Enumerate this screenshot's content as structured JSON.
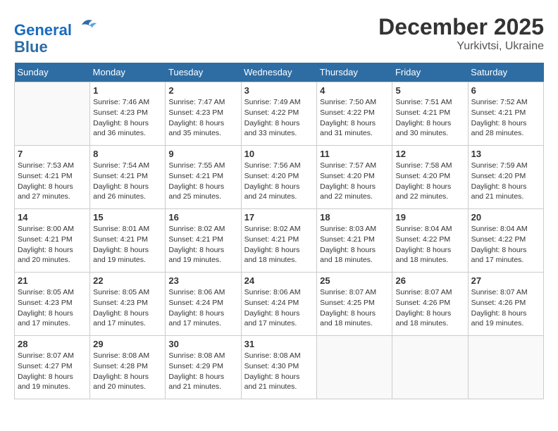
{
  "header": {
    "logo_line1": "General",
    "logo_line2": "Blue",
    "month": "December 2025",
    "location": "Yurkivtsi, Ukraine"
  },
  "weekdays": [
    "Sunday",
    "Monday",
    "Tuesday",
    "Wednesday",
    "Thursday",
    "Friday",
    "Saturday"
  ],
  "weeks": [
    [
      {
        "day": "",
        "text": ""
      },
      {
        "day": "1",
        "text": "Sunrise: 7:46 AM\nSunset: 4:23 PM\nDaylight: 8 hours\nand 36 minutes."
      },
      {
        "day": "2",
        "text": "Sunrise: 7:47 AM\nSunset: 4:23 PM\nDaylight: 8 hours\nand 35 minutes."
      },
      {
        "day": "3",
        "text": "Sunrise: 7:49 AM\nSunset: 4:22 PM\nDaylight: 8 hours\nand 33 minutes."
      },
      {
        "day": "4",
        "text": "Sunrise: 7:50 AM\nSunset: 4:22 PM\nDaylight: 8 hours\nand 31 minutes."
      },
      {
        "day": "5",
        "text": "Sunrise: 7:51 AM\nSunset: 4:21 PM\nDaylight: 8 hours\nand 30 minutes."
      },
      {
        "day": "6",
        "text": "Sunrise: 7:52 AM\nSunset: 4:21 PM\nDaylight: 8 hours\nand 28 minutes."
      }
    ],
    [
      {
        "day": "7",
        "text": "Sunrise: 7:53 AM\nSunset: 4:21 PM\nDaylight: 8 hours\nand 27 minutes."
      },
      {
        "day": "8",
        "text": "Sunrise: 7:54 AM\nSunset: 4:21 PM\nDaylight: 8 hours\nand 26 minutes."
      },
      {
        "day": "9",
        "text": "Sunrise: 7:55 AM\nSunset: 4:21 PM\nDaylight: 8 hours\nand 25 minutes."
      },
      {
        "day": "10",
        "text": "Sunrise: 7:56 AM\nSunset: 4:20 PM\nDaylight: 8 hours\nand 24 minutes."
      },
      {
        "day": "11",
        "text": "Sunrise: 7:57 AM\nSunset: 4:20 PM\nDaylight: 8 hours\nand 22 minutes."
      },
      {
        "day": "12",
        "text": "Sunrise: 7:58 AM\nSunset: 4:20 PM\nDaylight: 8 hours\nand 22 minutes."
      },
      {
        "day": "13",
        "text": "Sunrise: 7:59 AM\nSunset: 4:20 PM\nDaylight: 8 hours\nand 21 minutes."
      }
    ],
    [
      {
        "day": "14",
        "text": "Sunrise: 8:00 AM\nSunset: 4:21 PM\nDaylight: 8 hours\nand 20 minutes."
      },
      {
        "day": "15",
        "text": "Sunrise: 8:01 AM\nSunset: 4:21 PM\nDaylight: 8 hours\nand 19 minutes."
      },
      {
        "day": "16",
        "text": "Sunrise: 8:02 AM\nSunset: 4:21 PM\nDaylight: 8 hours\nand 19 minutes."
      },
      {
        "day": "17",
        "text": "Sunrise: 8:02 AM\nSunset: 4:21 PM\nDaylight: 8 hours\nand 18 minutes."
      },
      {
        "day": "18",
        "text": "Sunrise: 8:03 AM\nSunset: 4:21 PM\nDaylight: 8 hours\nand 18 minutes."
      },
      {
        "day": "19",
        "text": "Sunrise: 8:04 AM\nSunset: 4:22 PM\nDaylight: 8 hours\nand 18 minutes."
      },
      {
        "day": "20",
        "text": "Sunrise: 8:04 AM\nSunset: 4:22 PM\nDaylight: 8 hours\nand 17 minutes."
      }
    ],
    [
      {
        "day": "21",
        "text": "Sunrise: 8:05 AM\nSunset: 4:23 PM\nDaylight: 8 hours\nand 17 minutes."
      },
      {
        "day": "22",
        "text": "Sunrise: 8:05 AM\nSunset: 4:23 PM\nDaylight: 8 hours\nand 17 minutes."
      },
      {
        "day": "23",
        "text": "Sunrise: 8:06 AM\nSunset: 4:24 PM\nDaylight: 8 hours\nand 17 minutes."
      },
      {
        "day": "24",
        "text": "Sunrise: 8:06 AM\nSunset: 4:24 PM\nDaylight: 8 hours\nand 17 minutes."
      },
      {
        "day": "25",
        "text": "Sunrise: 8:07 AM\nSunset: 4:25 PM\nDaylight: 8 hours\nand 18 minutes."
      },
      {
        "day": "26",
        "text": "Sunrise: 8:07 AM\nSunset: 4:26 PM\nDaylight: 8 hours\nand 18 minutes."
      },
      {
        "day": "27",
        "text": "Sunrise: 8:07 AM\nSunset: 4:26 PM\nDaylight: 8 hours\nand 19 minutes."
      }
    ],
    [
      {
        "day": "28",
        "text": "Sunrise: 8:07 AM\nSunset: 4:27 PM\nDaylight: 8 hours\nand 19 minutes."
      },
      {
        "day": "29",
        "text": "Sunrise: 8:08 AM\nSunset: 4:28 PM\nDaylight: 8 hours\nand 20 minutes."
      },
      {
        "day": "30",
        "text": "Sunrise: 8:08 AM\nSunset: 4:29 PM\nDaylight: 8 hours\nand 21 minutes."
      },
      {
        "day": "31",
        "text": "Sunrise: 8:08 AM\nSunset: 4:30 PM\nDaylight: 8 hours\nand 21 minutes."
      },
      {
        "day": "",
        "text": ""
      },
      {
        "day": "",
        "text": ""
      },
      {
        "day": "",
        "text": ""
      }
    ]
  ]
}
